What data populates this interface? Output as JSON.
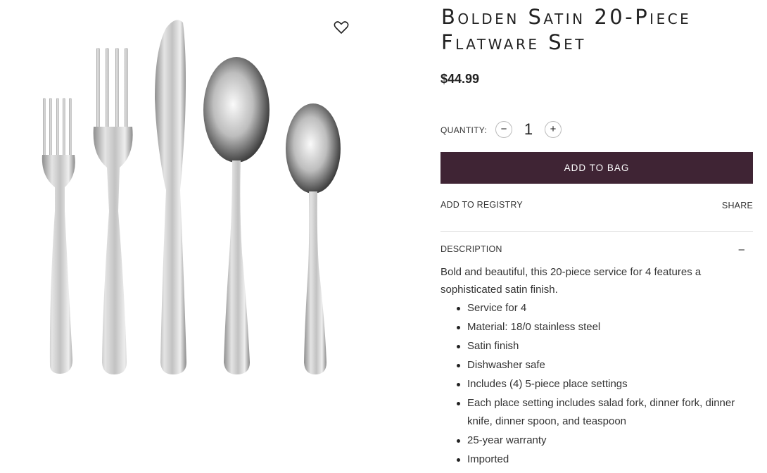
{
  "product": {
    "title_line1": "Bolden Satin 20-Piece",
    "title_line2": "Flatware Set",
    "price": "$44.99"
  },
  "quantity": {
    "label": "QUANTITY:",
    "value": "1",
    "minus_glyph": "−",
    "plus_glyph": "+"
  },
  "actions": {
    "add_to_bag": "ADD TO BAG",
    "add_to_registry": "ADD TO REGISTRY",
    "share": "SHARE",
    "favorite_icon": "heart-outline-icon"
  },
  "description": {
    "label": "DESCRIPTION",
    "collapse_glyph": "–",
    "text": "Bold and beautiful, this 20-piece service for 4 features a sophisticated satin finish.",
    "features": [
      "Service for 4",
      "Material: 18/0 stainless steel",
      "Satin finish",
      "Dishwasher safe",
      "Includes (4) 5-piece place settings",
      "Each place setting includes salad fork, dinner fork, dinner knife, dinner spoon, and teaspoon",
      "25-year warranty",
      "Imported"
    ]
  },
  "colors": {
    "accent": "#3f2434",
    "text": "#222222",
    "divider": "#dcdcdc"
  }
}
